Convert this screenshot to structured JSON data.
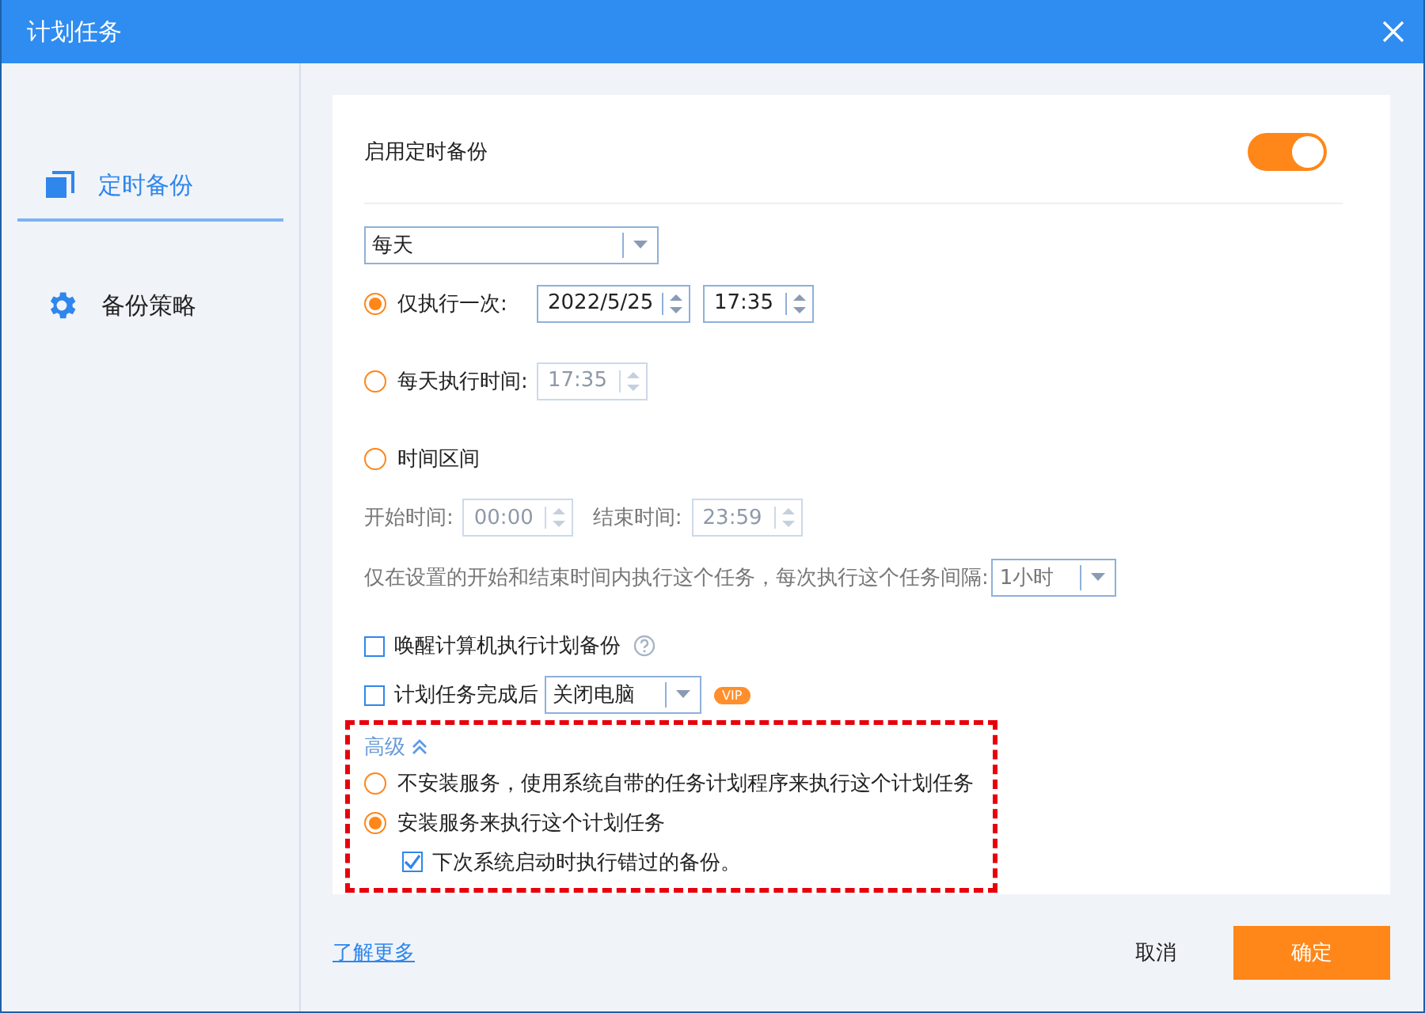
{
  "window": {
    "title": "计划任务"
  },
  "sidebar": {
    "items": [
      {
        "label": "定时备份",
        "selected": true,
        "kind": "schedule"
      },
      {
        "label": "备份策略",
        "selected": false,
        "kind": "settings"
      }
    ]
  },
  "schedule": {
    "enable": {
      "label": "启用定时备份",
      "on": true
    },
    "frequency": {
      "value": "每天"
    },
    "modes": [
      {
        "label": "仅执行一次:",
        "selected": true,
        "fields": [
          {
            "kind": "date",
            "value": "2022/5/25",
            "disabled": false
          },
          {
            "kind": "time",
            "value": "17:35",
            "disabled": false
          }
        ]
      },
      {
        "label": "每天执行时间:",
        "selected": false,
        "fields": [
          {
            "kind": "time",
            "value": "17:35",
            "disabled": true
          }
        ]
      },
      {
        "label": "时间区间",
        "selected": false
      }
    ],
    "range": {
      "start_label": "开始时间:",
      "start": "00:00",
      "end_label": "结束时间:",
      "end": "23:59",
      "disabled": true
    },
    "interval": {
      "text": "仅在设置的开始和结束时间内执行这个任务，每次执行这个任务间隔:",
      "value": "1小时"
    },
    "wake": {
      "label": "唤醒计算机执行计划备份",
      "checked": false
    },
    "after": {
      "label": "计划任务完成后",
      "checked": false,
      "action": "关闭电脑",
      "badge": "VIP"
    }
  },
  "advanced": {
    "title": "高级",
    "expanded": true,
    "services": [
      {
        "label": "不安装服务，使用系统自带的任务计划程序来执行这个计划任务",
        "selected": false
      },
      {
        "label": "安装服务来执行这个计划任务",
        "selected": true
      }
    ],
    "retry": {
      "label": "下次系统启动时执行错过的备份。",
      "checked": true
    }
  },
  "footer": {
    "link": "了解更多",
    "cancel": "取消",
    "ok": "确定"
  }
}
